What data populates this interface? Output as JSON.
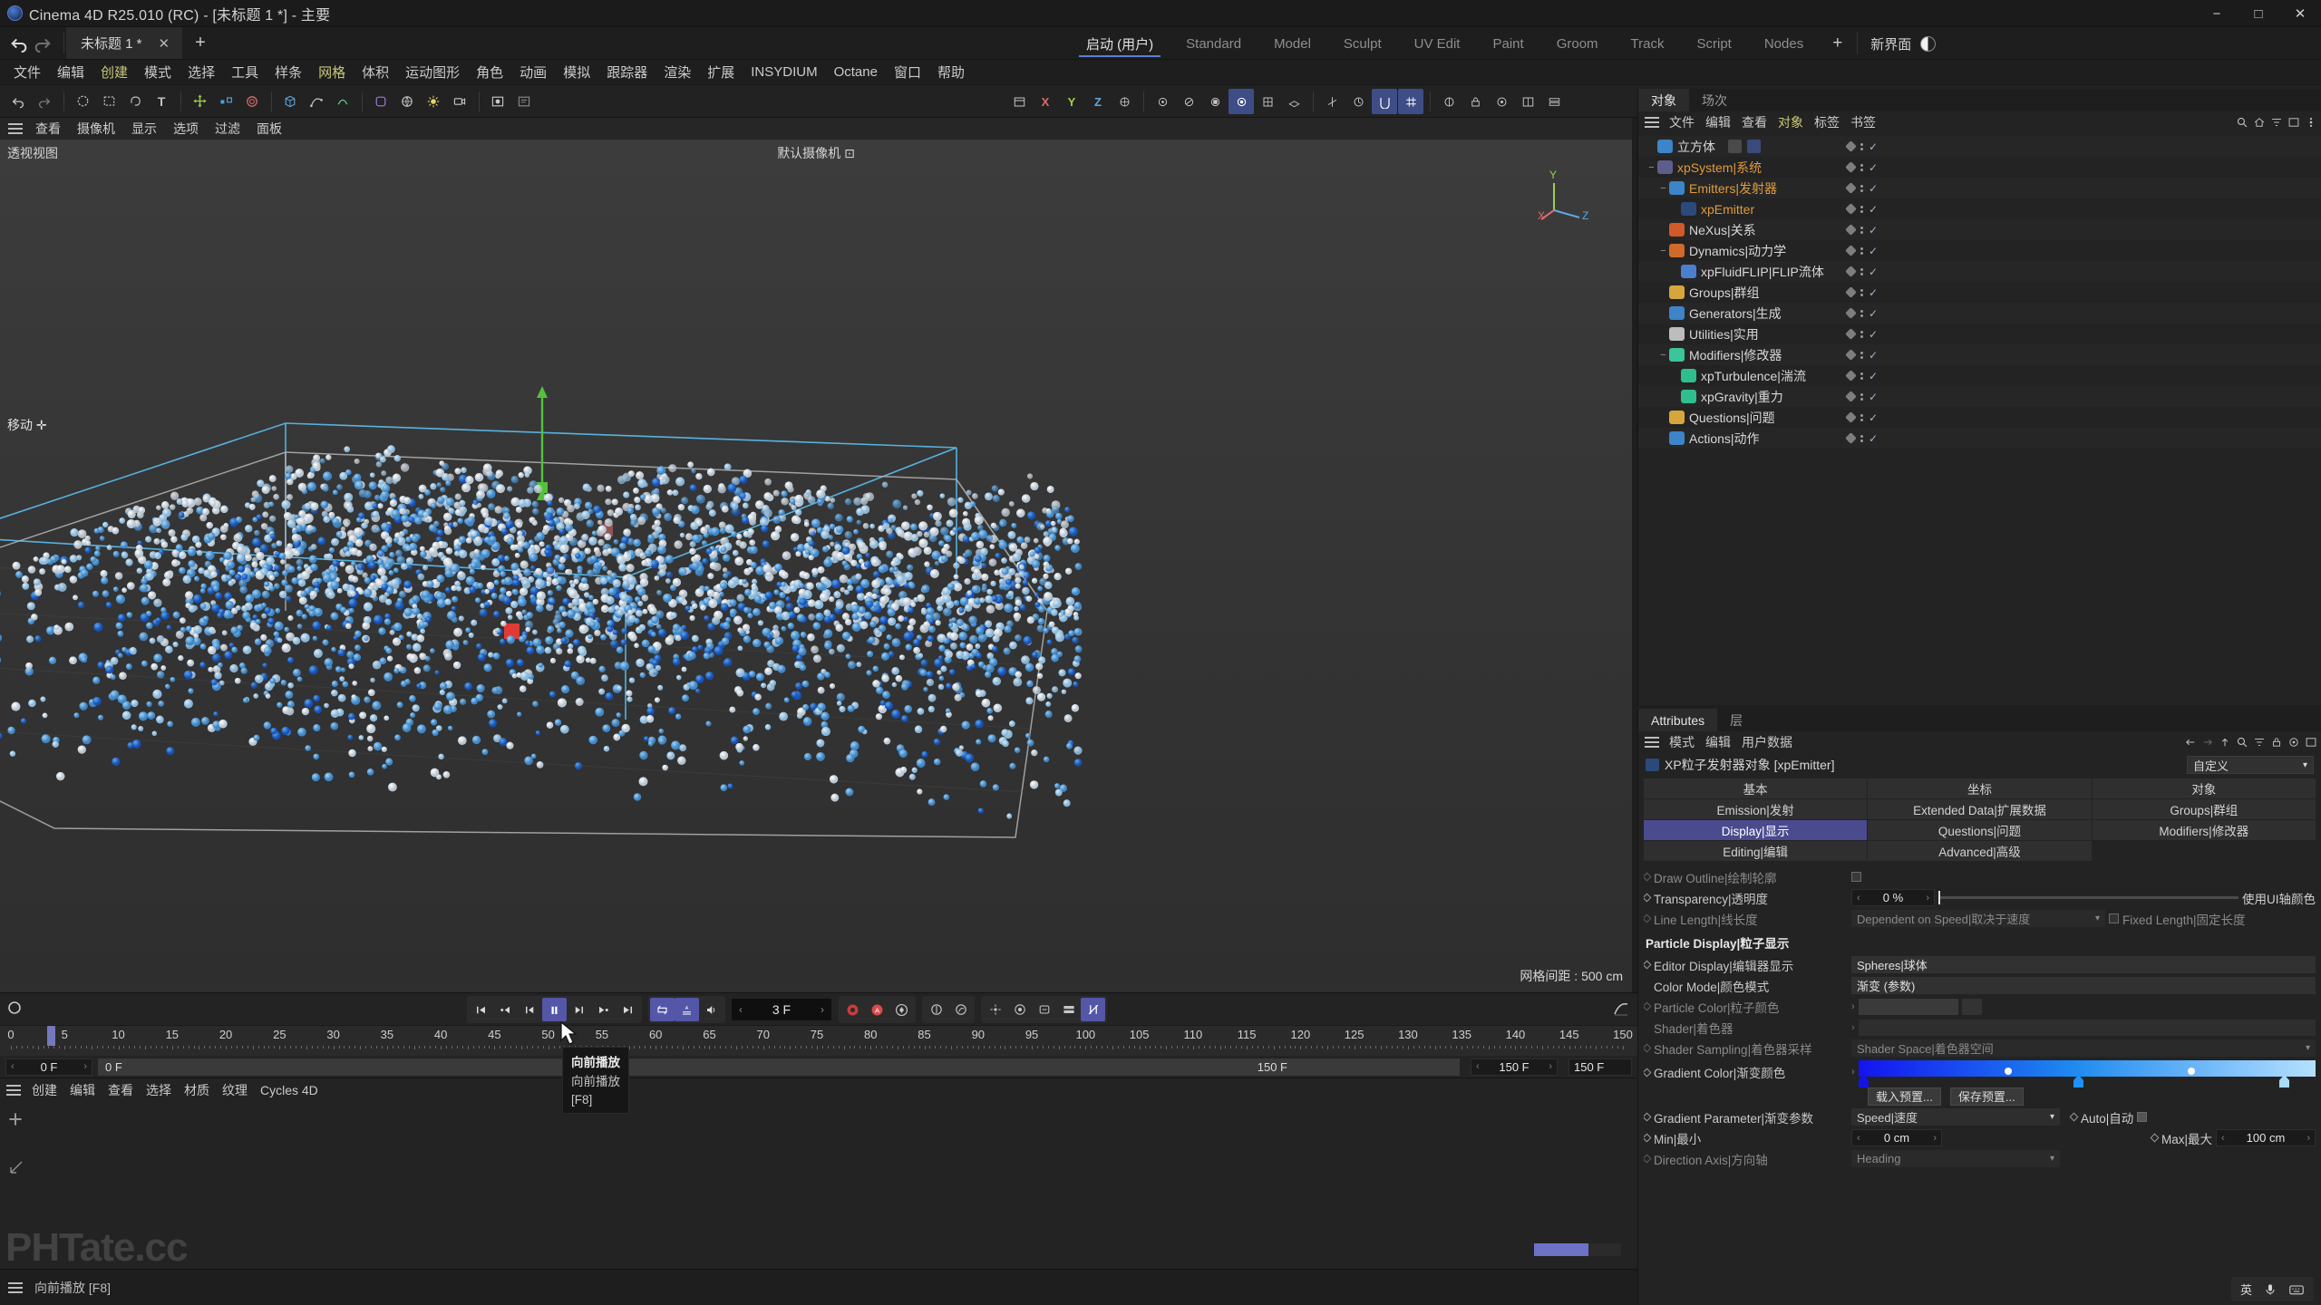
{
  "titlebar": {
    "title": "Cinema 4D R25.010 (RC) - [未标题 1 *] - 主要",
    "minimize": "−",
    "maximize": "□",
    "close": "✕"
  },
  "tabstrip": {
    "doc_tab": "未标题 1 *",
    "close_tab": "✕",
    "add_tab": "+",
    "layouts": [
      "启动 (用户)",
      "Standard",
      "Model",
      "Sculpt",
      "UV Edit",
      "Paint",
      "Groom",
      "Track",
      "Script",
      "Nodes"
    ],
    "active_layout": "启动 (用户)",
    "add_layout": "+",
    "new_ui": "新界面"
  },
  "menubar": {
    "items": [
      "文件",
      "编辑",
      "创建",
      "模式",
      "选择",
      "工具",
      "样条",
      "网格",
      "体积",
      "运动图形",
      "角色",
      "动画",
      "模拟",
      "跟踪器",
      "渲染",
      "扩展",
      "INSYDIUM",
      "Octane",
      "窗口",
      "帮助"
    ],
    "highlighted": [
      "创建",
      "网格"
    ]
  },
  "viewport": {
    "menu": [
      "查看",
      "摄像机",
      "显示",
      "选项",
      "过滤",
      "面板"
    ],
    "label": "透视视图",
    "camera_label": "默认摄像机 ⊡",
    "tool_label": "移动 ✛",
    "grid_label": "网格间距 : 500 cm",
    "axis": {
      "x": "X",
      "y": "Y",
      "z": "Z"
    }
  },
  "object_manager": {
    "tabs": [
      "对象",
      "场次"
    ],
    "active_tab": "对象",
    "menu": [
      "文件",
      "编辑",
      "查看",
      "对象",
      "标签",
      "书签"
    ],
    "menu_highlighted": "对象",
    "items": [
      {
        "label": "立方体",
        "depth": 0,
        "twisty": "",
        "icon_color": "#3d84c8",
        "text_color": "#d8d8d8",
        "has_tag": true
      },
      {
        "label": "xpSystem|系统",
        "depth": 0,
        "twisty": "−",
        "icon_color": "#5d5d8e",
        "text_color": "#e09a3e",
        "has_tag": false
      },
      {
        "label": "Emitters|发射器",
        "depth": 1,
        "twisty": "−",
        "icon_color": "#3d84c8",
        "text_color": "#e09a3e",
        "has_tag": false
      },
      {
        "label": "xpEmitter",
        "depth": 2,
        "twisty": "",
        "icon_color": "#2b4a7a",
        "text_color": "#e09a3e",
        "has_tag": false
      },
      {
        "label": "NeXus|关系",
        "depth": 1,
        "twisty": "",
        "icon_color": "#d05a28",
        "text_color": "#d8d8d8",
        "has_tag": false
      },
      {
        "label": "Dynamics|动力学",
        "depth": 1,
        "twisty": "−",
        "icon_color": "#cf6a2b",
        "text_color": "#d8d8d8",
        "has_tag": false
      },
      {
        "label": "xpFluidFLIP|FLIP流体",
        "depth": 2,
        "twisty": "",
        "icon_color": "#4a7fd0",
        "text_color": "#d8d8d8",
        "has_tag": false
      },
      {
        "label": "Groups|群组",
        "depth": 1,
        "twisty": "",
        "icon_color": "#d6a63c",
        "text_color": "#d8d8d8",
        "has_tag": false
      },
      {
        "label": "Generators|生成",
        "depth": 1,
        "twisty": "",
        "icon_color": "#3d84c8",
        "text_color": "#d8d8d8",
        "has_tag": false
      },
      {
        "label": "Utilities|实用",
        "depth": 1,
        "twisty": "",
        "icon_color": "#bdbdbd",
        "text_color": "#d8d8d8",
        "has_tag": false
      },
      {
        "label": "Modifiers|修改器",
        "depth": 1,
        "twisty": "−",
        "icon_color": "#3cc49a",
        "text_color": "#d8d8d8",
        "has_tag": false
      },
      {
        "label": "xpTurbulence|湍流",
        "depth": 2,
        "twisty": "",
        "icon_color": "#2fbf8f",
        "text_color": "#d8d8d8",
        "has_tag": false
      },
      {
        "label": "xpGravity|重力",
        "depth": 2,
        "twisty": "",
        "icon_color": "#2fbf8f",
        "text_color": "#d8d8d8",
        "has_tag": false
      },
      {
        "label": "Questions|问题",
        "depth": 1,
        "twisty": "",
        "icon_color": "#d6a63c",
        "text_color": "#d8d8d8",
        "has_tag": false
      },
      {
        "label": "Actions|动作",
        "depth": 1,
        "twisty": "",
        "icon_color": "#3d84c8",
        "text_color": "#d8d8d8",
        "has_tag": false
      }
    ]
  },
  "attributes": {
    "tabs": [
      "Attributes",
      "层"
    ],
    "active_tab": "Attributes",
    "menu": [
      "模式",
      "编辑",
      "用户数据"
    ],
    "object_title": "XP粒子发射器对象 [xpEmitter]",
    "preset": "自定义",
    "tab_grid": [
      [
        "基本",
        "坐标",
        "对象"
      ],
      [
        "Emission|发射",
        "Extended Data|扩展数据",
        "Groups|群组"
      ],
      [
        "Display|显示",
        "Questions|问题",
        "Modifiers|修改器"
      ],
      [
        "Editing|编辑",
        "Advanced|高级",
        ""
      ]
    ],
    "selected_tab": "Display|显示",
    "props": {
      "draw_outline_label": "Draw Outline|绘制轮廓",
      "transparency_label": "Transparency|透明度",
      "transparency_value": "0 %",
      "use_ui_axis_color": "使用UI轴颜色",
      "line_length_label": "Line Length|线长度",
      "line_length_value": "Dependent on Speed|取决于速度",
      "fixed_length_label": "Fixed Length|固定长度",
      "section_particle_display": "Particle Display|粒子显示",
      "editor_display_label": "Editor Display|编辑器显示",
      "editor_display_value": "Spheres|球体",
      "color_mode_label": "Color Mode|颜色模式",
      "color_mode_value": "渐变 (参数)",
      "particle_color_label": "Particle Color|粒子颜色",
      "shader_label": "Shader|着色器",
      "shader_sampling_label": "Shader Sampling|着色器采样",
      "shader_sampling_value": "Shader Space|着色器空间",
      "gradient_color_label": "Gradient Color|渐变颜色",
      "load_preset": "载入预置...",
      "save_preset": "保存预置...",
      "gradient_parameter_label": "Gradient Parameter|渐变参数",
      "gradient_parameter_value": "Speed|速度",
      "auto_label": "Auto|自动",
      "min_label": "Min|最小",
      "min_value": "0 cm",
      "max_label": "Max|最大",
      "max_value": "100 cm",
      "direction_axis_label": "Direction Axis|方向轴",
      "direction_axis_value": "Heading"
    },
    "gradient": {
      "start": "#1414f0",
      "mid": "#1e8af0",
      "end": "#b4e0ff",
      "stops": [
        "#1414e6",
        "#1e90ff",
        "#a8dcfb"
      ]
    }
  },
  "timeline": {
    "current_frame": "3 F",
    "start_frame": "0 F",
    "end_frame_a": "0 F",
    "range_label_1": "150 F",
    "range_label_2": "150 F",
    "range_label_3": "150 F",
    "ticks": [
      "0",
      "5",
      "10",
      "15",
      "20",
      "25",
      "30",
      "35",
      "40",
      "45",
      "50",
      "55",
      "60",
      "65",
      "70",
      "75",
      "80",
      "85",
      "90",
      "95",
      "100",
      "105",
      "110",
      "115",
      "120",
      "125",
      "130",
      "135",
      "140",
      "145",
      "150"
    ],
    "transport": [
      "goto-start",
      "step-back-key",
      "step-back",
      "play-pause",
      "step-forward",
      "step-forward-key",
      "goto-end"
    ]
  },
  "tooltip": {
    "title": "向前播放",
    "desc": "向前播放",
    "shortcut": "[F8]"
  },
  "material_manager": {
    "menu": [
      "创建",
      "编辑",
      "查看",
      "选择",
      "材质",
      "纹理",
      "Cycles 4D"
    ]
  },
  "statusbar": {
    "text": "向前播放 [F8]",
    "progress_percent": 62
  },
  "watermark": "PHTate.cc",
  "ime": {
    "lang": "英",
    "icons": [
      "mic-icon",
      "keyboard-icon"
    ]
  }
}
